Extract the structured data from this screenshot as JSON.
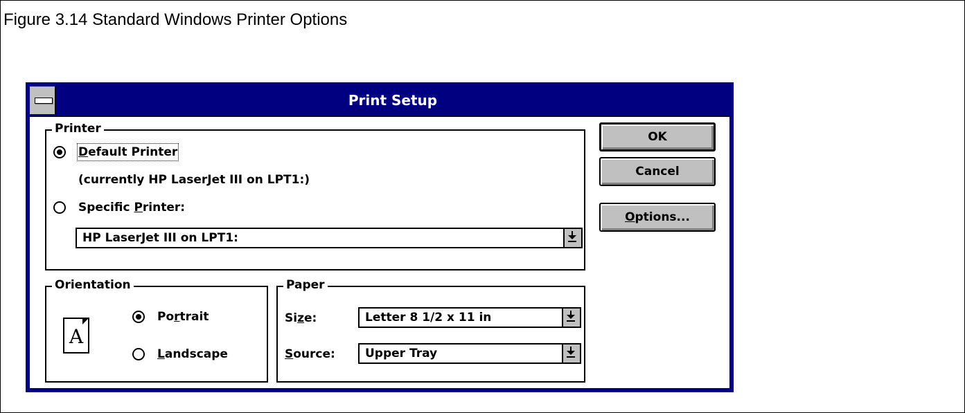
{
  "figure_caption": "Figure 3.14  Standard Windows Printer Options",
  "dialog": {
    "title": "Print Setup",
    "printer_group": {
      "label": "Printer",
      "default_printer": {
        "label_accel": "D",
        "label_rest": "efault Printer",
        "checked": true
      },
      "current_note": "(currently HP LaserJet III on LPT1:)",
      "specific_printer": {
        "label_pre": "Specific ",
        "label_accel": "P",
        "label_rest": "rinter:",
        "checked": false
      },
      "specific_printer_select": "HP LaserJet III on LPT1:"
    },
    "orientation_group": {
      "label": "Orientation",
      "icon_letter": "A",
      "portrait": {
        "label_pre": "Po",
        "label_accel": "r",
        "label_rest": "trait",
        "checked": true
      },
      "landscape": {
        "label_accel": "L",
        "label_rest": "andscape",
        "checked": false
      }
    },
    "paper_group": {
      "label": "Paper",
      "size": {
        "label_pre": "Si",
        "label_accel": "z",
        "label_rest": "e:",
        "value": "Letter 8 1/2 x 11 in"
      },
      "source": {
        "label_accel": "S",
        "label_rest": "ource:",
        "value": "Upper Tray"
      }
    },
    "buttons": {
      "ok": "OK",
      "cancel": "Cancel",
      "options_accel": "O",
      "options_rest": "ptions..."
    }
  }
}
